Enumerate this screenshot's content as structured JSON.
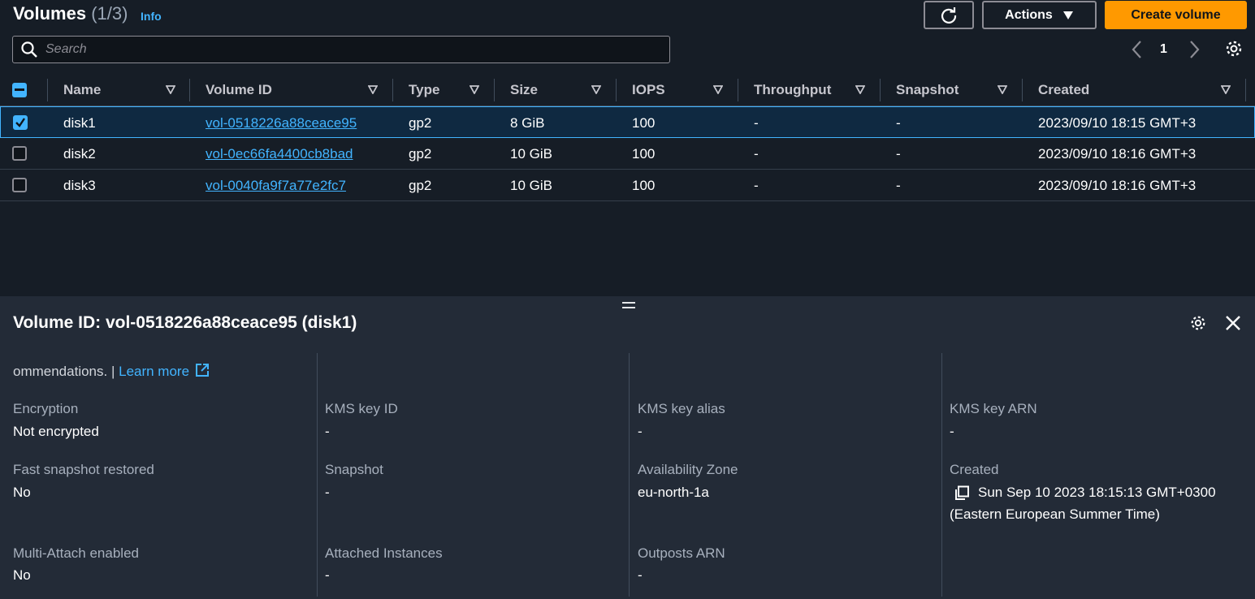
{
  "header": {
    "title": "Volumes",
    "count": "(1/3)",
    "info": "Info",
    "actions_label": "Actions",
    "create_label": "Create volume"
  },
  "search": {
    "placeholder": "Search"
  },
  "pagination": {
    "current_page": "1"
  },
  "table": {
    "columns": [
      "Name",
      "Volume ID",
      "Type",
      "Size",
      "IOPS",
      "Throughput",
      "Snapshot",
      "Created"
    ],
    "rows": [
      {
        "name": "disk1",
        "volume_id": "vol-0518226a88ceace95",
        "type": "gp2",
        "size": "8 GiB",
        "iops": "100",
        "throughput": "-",
        "snapshot": "-",
        "created": "2023/09/10 18:15 GMT+3",
        "selected": true
      },
      {
        "name": "disk2",
        "volume_id": "vol-0ec66fa4400cb8bad",
        "type": "gp2",
        "size": "10 GiB",
        "iops": "100",
        "throughput": "-",
        "snapshot": "-",
        "created": "2023/09/10 18:16 GMT+3",
        "selected": false
      },
      {
        "name": "disk3",
        "volume_id": "vol-0040fa9f7a77e2fc7",
        "type": "gp2",
        "size": "10 GiB",
        "iops": "100",
        "throughput": "-",
        "snapshot": "-",
        "created": "2023/09/10 18:16 GMT+3",
        "selected": false
      }
    ]
  },
  "details": {
    "title": "Volume ID: vol-0518226a88ceace95 (disk1)",
    "partial_text": "ommendations. |",
    "learn_more": "Learn more",
    "fields": {
      "encryption": {
        "label": "Encryption",
        "value": "Not encrypted"
      },
      "kms_key_id": {
        "label": "KMS key ID",
        "value": "-"
      },
      "kms_key_alias": {
        "label": "KMS key alias",
        "value": "-"
      },
      "kms_key_arn": {
        "label": "KMS key ARN",
        "value": "-"
      },
      "fast_snapshot": {
        "label": "Fast snapshot restored",
        "value": "No"
      },
      "snapshot": {
        "label": "Snapshot",
        "value": "-"
      },
      "availability_zone": {
        "label": "Availability Zone",
        "value": "eu-north-1a"
      },
      "created": {
        "label": "Created",
        "value": "Sun Sep 10 2023 18:15:13 GMT+0300",
        "value2": "(Eastern European Summer Time)"
      },
      "multi_attach": {
        "label": "Multi-Attach enabled",
        "value": "No"
      },
      "attached_instances": {
        "label": "Attached Instances",
        "value": "-"
      },
      "outposts_arn": {
        "label": "Outposts ARN",
        "value": "-"
      }
    }
  },
  "colors": {
    "accent": "#42b4ff",
    "primary_button": "#ff9900"
  }
}
